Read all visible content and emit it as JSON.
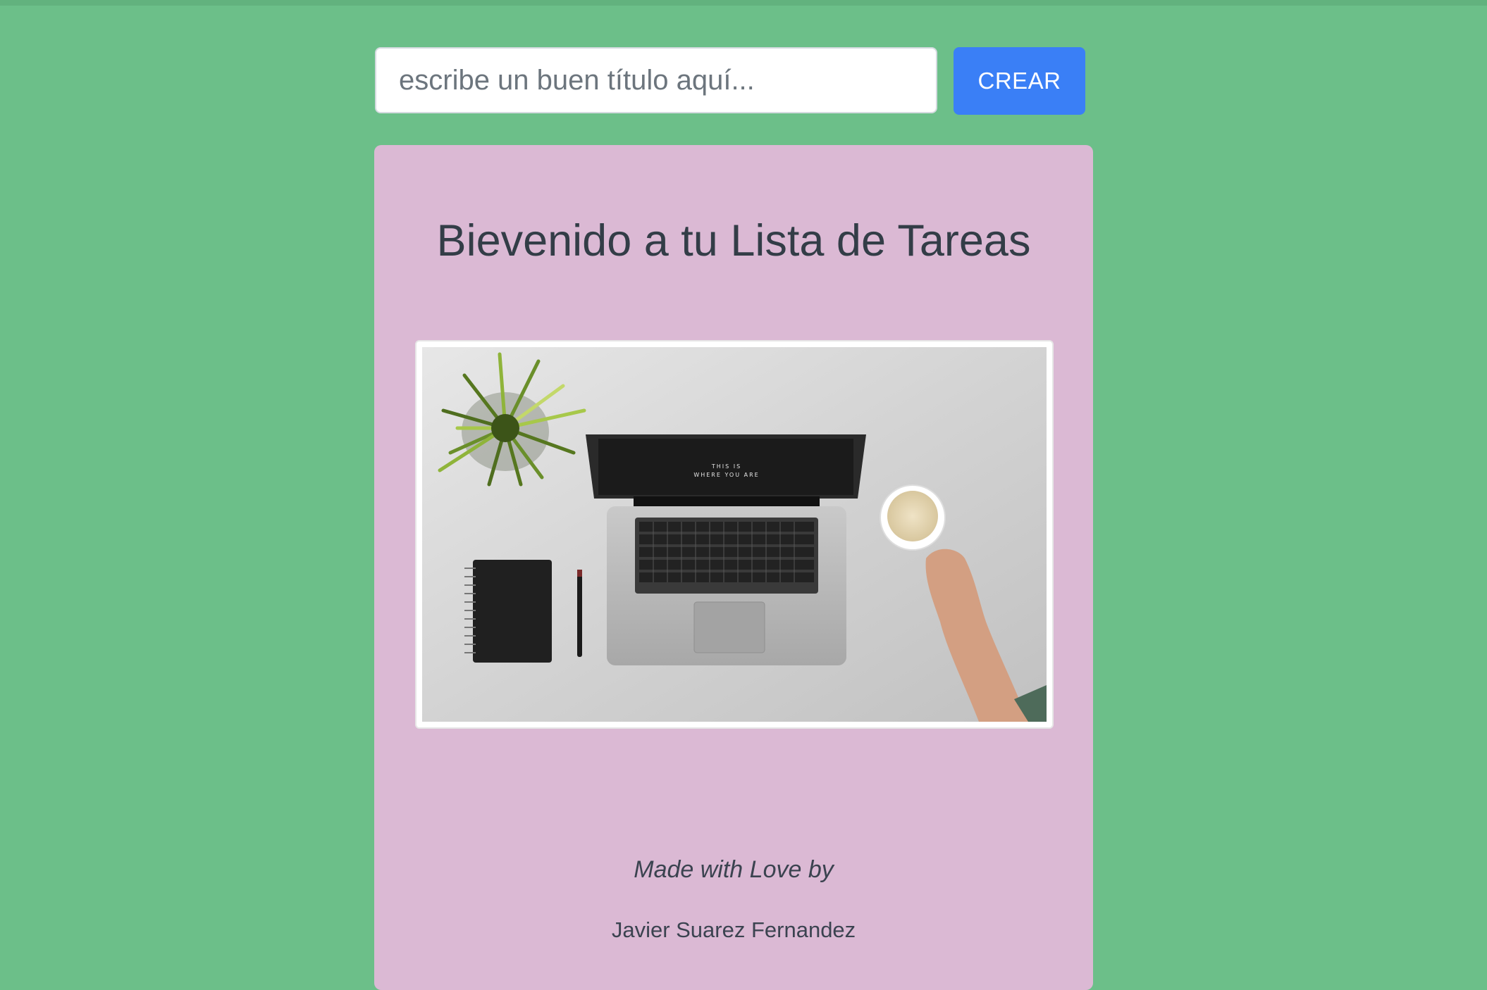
{
  "form": {
    "title_input": {
      "value": "",
      "placeholder": "escribe un buen título aquí..."
    },
    "create_button_label": "CREAR"
  },
  "card": {
    "title": "Bievenido a tu Lista de Tareas",
    "image": {
      "screen_text_line1": "THIS IS",
      "screen_text_line2": "WHERE YOU ARE"
    },
    "footer": {
      "made_with": "Made with Love by",
      "author": "Javier Suarez Fernandez"
    }
  },
  "colors": {
    "page_background": "#6cbf89",
    "card_background": "#dbb9d4",
    "button_primary": "#3a7ff6",
    "title_text": "#333d47"
  }
}
